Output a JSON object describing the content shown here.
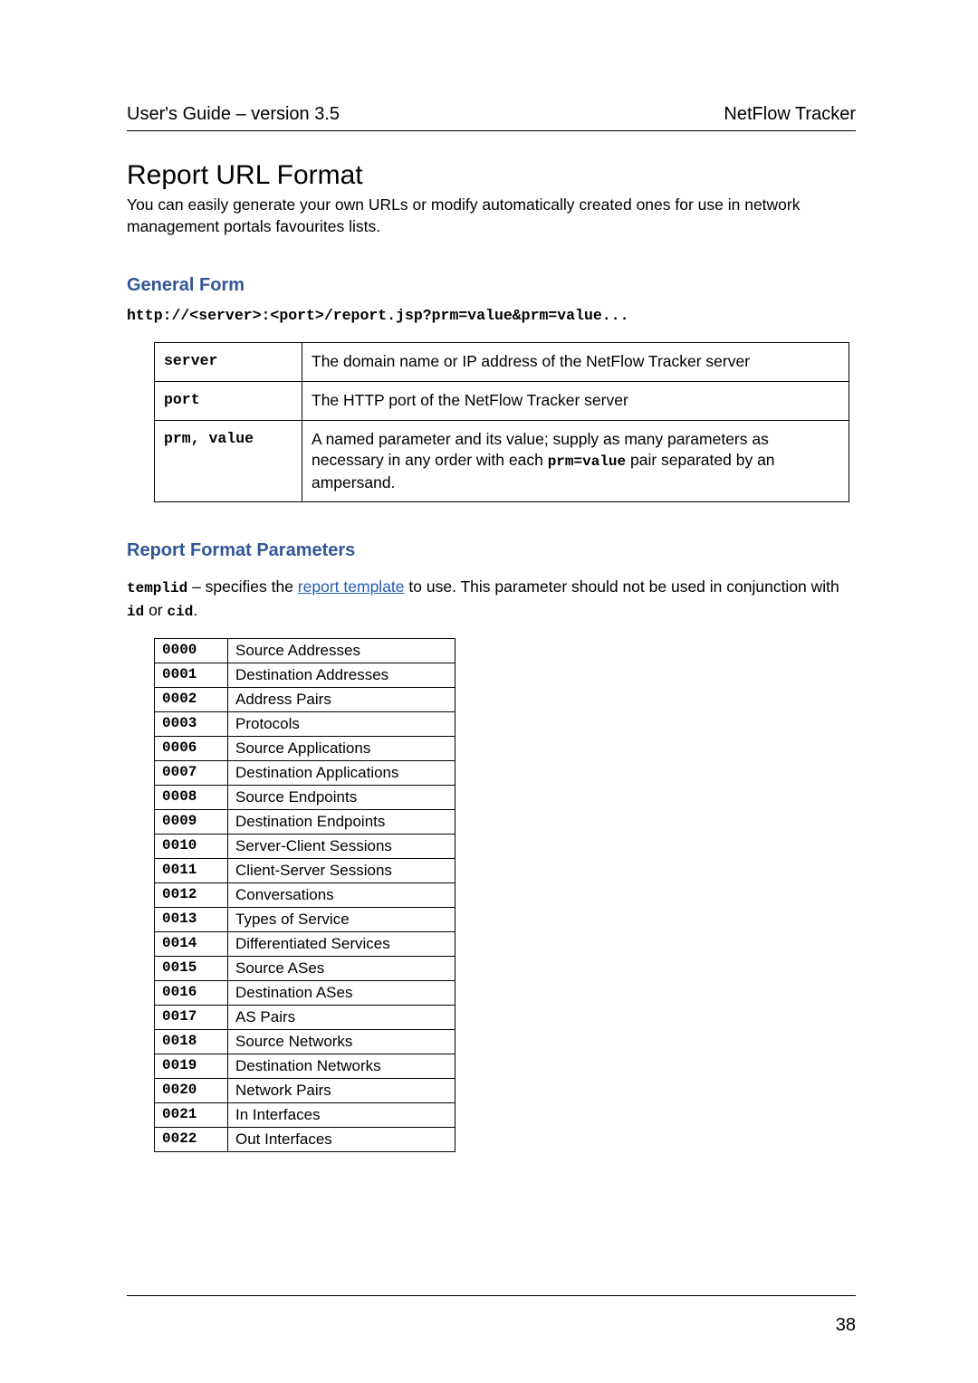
{
  "header": {
    "left": "User's Guide – version 3.5",
    "right": "NetFlow Tracker"
  },
  "title": "Report URL Format",
  "intro": "You can easily generate your own URLs or modify automatically created ones for use in network management portals favourites lists.",
  "general": {
    "heading": "General Form",
    "url": "http://<server>:<port>/report.jsp?prm=value&prm=value...",
    "rows": [
      {
        "key": "server",
        "desc": "The domain name or IP address of the NetFlow Tracker server"
      },
      {
        "key": "port",
        "desc": "The HTTP port of the NetFlow Tracker server"
      },
      {
        "key": "prm, value",
        "desc_pre": "A named parameter and its value; supply as many parameters as necessary in any order with each ",
        "desc_code": "prm=value",
        "desc_post": " pair separated by an ampersand."
      }
    ]
  },
  "params": {
    "heading": "Report Format Parameters",
    "templid": {
      "label": "templid",
      "pre": " – specifies the ",
      "link": "report template",
      "post": " to use. This parameter should not be used in conjunction with ",
      "code1": "id",
      "or": " or ",
      "code2": "cid",
      "end": "."
    },
    "rows": [
      {
        "code": "0000",
        "desc": "Source Addresses"
      },
      {
        "code": "0001",
        "desc": "Destination Addresses"
      },
      {
        "code": "0002",
        "desc": "Address Pairs"
      },
      {
        "code": "0003",
        "desc": "Protocols"
      },
      {
        "code": "0006",
        "desc": "Source Applications"
      },
      {
        "code": "0007",
        "desc": "Destination Applications"
      },
      {
        "code": "0008",
        "desc": "Source Endpoints"
      },
      {
        "code": "0009",
        "desc": "Destination Endpoints"
      },
      {
        "code": "0010",
        "desc": "Server-Client Sessions"
      },
      {
        "code": "0011",
        "desc": "Client-Server Sessions"
      },
      {
        "code": "0012",
        "desc": "Conversations"
      },
      {
        "code": "0013",
        "desc": "Types of Service"
      },
      {
        "code": "0014",
        "desc": "Differentiated Services"
      },
      {
        "code": "0015",
        "desc": "Source ASes"
      },
      {
        "code": "0016",
        "desc": "Destination ASes"
      },
      {
        "code": "0017",
        "desc": "AS Pairs"
      },
      {
        "code": "0018",
        "desc": "Source Networks"
      },
      {
        "code": "0019",
        "desc": "Destination Networks"
      },
      {
        "code": "0020",
        "desc": "Network Pairs"
      },
      {
        "code": "0021",
        "desc": "In Interfaces"
      },
      {
        "code": "0022",
        "desc": "Out Interfaces"
      }
    ]
  },
  "page_number": "38"
}
